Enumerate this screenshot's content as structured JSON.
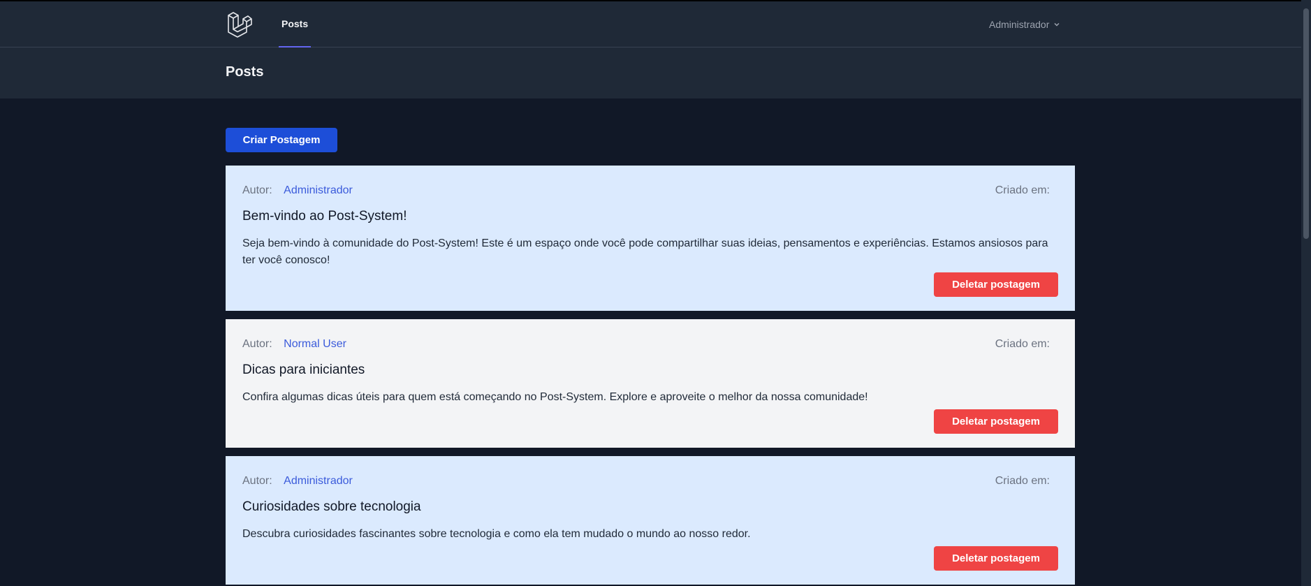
{
  "nav": {
    "logo_icon": "laravel-logo-icon",
    "links": [
      {
        "label": "Posts",
        "active": true
      }
    ],
    "user": {
      "name": "Administrador",
      "icon": "chevron-down-icon"
    }
  },
  "header": {
    "title": "Posts"
  },
  "actions": {
    "create_label": "Criar Postagem"
  },
  "posts": [
    {
      "author_label": "Autor:",
      "author": "Administrador",
      "created_label": "Criado em:",
      "title": "Bem-vindo ao Post-System!",
      "body": "Seja bem-vindo à comunidade do Post-System! Este é um espaço onde você pode compartilhar suas ideias, pensamentos e experiências. Estamos ansiosos para ter você conosco!",
      "delete_label": "Deletar postagem"
    },
    {
      "author_label": "Autor:",
      "author": "Normal User",
      "created_label": "Criado em:",
      "title": "Dicas para iniciantes",
      "body": "Confira algumas dicas úteis para quem está começando no Post-System. Explore e aproveite o melhor da nossa comunidade!",
      "delete_label": "Deletar postagem"
    },
    {
      "author_label": "Autor:",
      "author": "Administrador",
      "created_label": "Criado em:",
      "title": "Curiosidades sobre tecnologia",
      "body": "Descubra curiosidades fascinantes sobre tecnologia e como ela tem mudado o mundo ao nosso redor.",
      "delete_label": "Deletar postagem"
    }
  ],
  "colors": {
    "background": "#111827",
    "navbar": "#1f2937",
    "primary_button": "#1d4ed8",
    "danger_button": "#ef4444",
    "card_blue": "#dbeafe",
    "card_gray": "#f3f4f6",
    "author_link": "#3b5bdb"
  }
}
